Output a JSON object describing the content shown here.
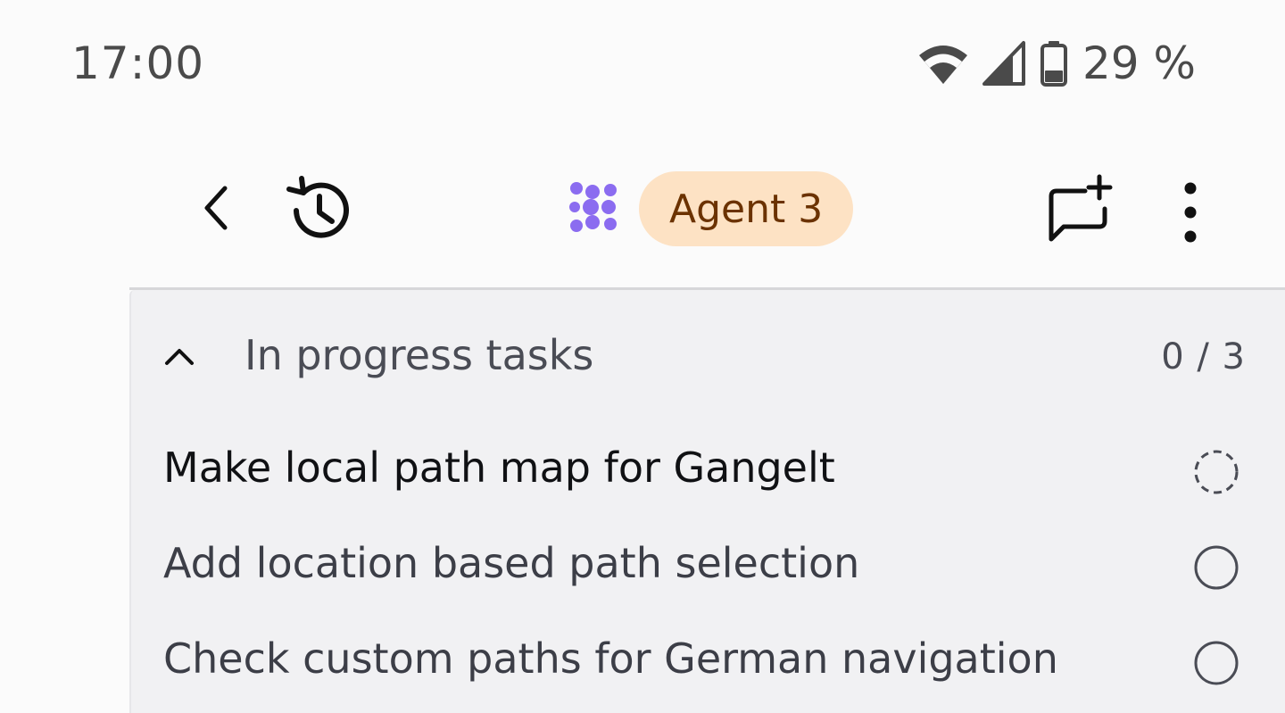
{
  "status_bar": {
    "time": "17:00",
    "battery_percent": "29 %",
    "icons": [
      "wifi-icon",
      "cell-signal-icon",
      "battery-icon"
    ]
  },
  "toolbar": {
    "back_icon": "chevron-left-icon",
    "history_icon": "history-icon",
    "agent_logo_icon": "agent-logo-icon",
    "agent_name": "Agent 3",
    "new_chat_icon": "new-chat-icon",
    "more_icon": "more-vertical-icon"
  },
  "tasks": {
    "title": "In progress tasks",
    "count": "0 / 3",
    "expanded": true,
    "items": [
      {
        "label": "Make local path map for Gangelt",
        "status": "in-progress"
      },
      {
        "label": "Add location based path selection",
        "status": "pending"
      },
      {
        "label": "Check custom paths for German navigation",
        "status": "pending"
      }
    ]
  },
  "colors": {
    "background": "#fbfbfb",
    "panel": "#f1f1f3",
    "agent_pill_bg": "#fde2c4",
    "agent_pill_text": "#6b3200",
    "agent_logo": "#8b6cf0",
    "status_text": "#4a4a4a"
  }
}
